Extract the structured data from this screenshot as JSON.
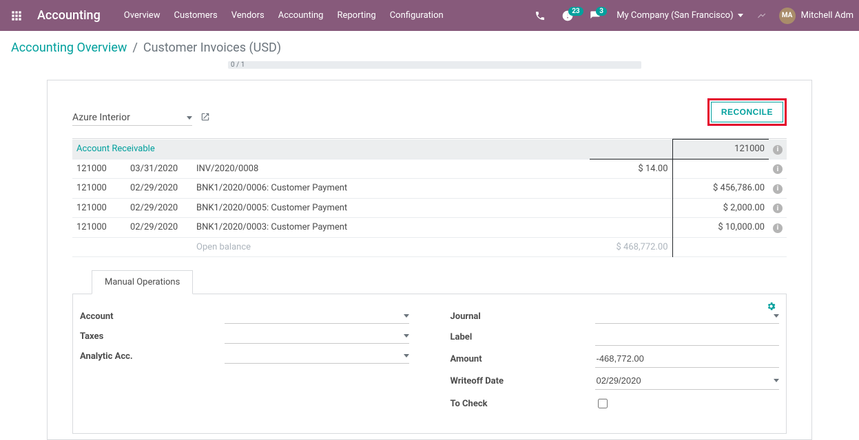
{
  "topbar": {
    "app_title": "Accounting",
    "nav": [
      "Overview",
      "Customers",
      "Vendors",
      "Accounting",
      "Reporting",
      "Configuration"
    ],
    "activity_badge": "23",
    "discuss_badge": "3",
    "company": "My Company (San Francisco)",
    "user": "Mitchell Adm"
  },
  "breadcrumb": {
    "parent": "Accounting Overview",
    "current": "Customer Invoices (USD)",
    "pager": "0 / 1"
  },
  "partner": {
    "name": "Azure Interior"
  },
  "actions": {
    "reconcile": "Reconcile"
  },
  "header": {
    "account_label": "Account Receivable",
    "account_code": "121000"
  },
  "lines": [
    {
      "code": "121000",
      "date": "03/31/2020",
      "label": "INV/2020/0008",
      "debit": "$ 14.00",
      "credit": ""
    },
    {
      "code": "121000",
      "date": "02/29/2020",
      "label": "BNK1/2020/0006: Customer Payment",
      "debit": "",
      "credit": "$ 456,786.00"
    },
    {
      "code": "121000",
      "date": "02/29/2020",
      "label": "BNK1/2020/0005: Customer Payment",
      "debit": "",
      "credit": "$ 2,000.00"
    },
    {
      "code": "121000",
      "date": "02/29/2020",
      "label": "BNK1/2020/0003: Customer Payment",
      "debit": "",
      "credit": "$ 10,000.00"
    }
  ],
  "open_balance": {
    "label": "Open balance",
    "debit": "$ 468,772.00",
    "credit": ""
  },
  "tabs": {
    "manual_ops": "Manual Operations"
  },
  "form": {
    "left": {
      "account": "Account",
      "taxes": "Taxes",
      "analytic": "Analytic Acc."
    },
    "right": {
      "journal": "Journal",
      "label": "Label",
      "amount": "Amount",
      "amount_value": "-468,772.00",
      "writeoff_date": "Writeoff Date",
      "writeoff_date_value": "02/29/2020",
      "to_check": "To Check"
    }
  }
}
